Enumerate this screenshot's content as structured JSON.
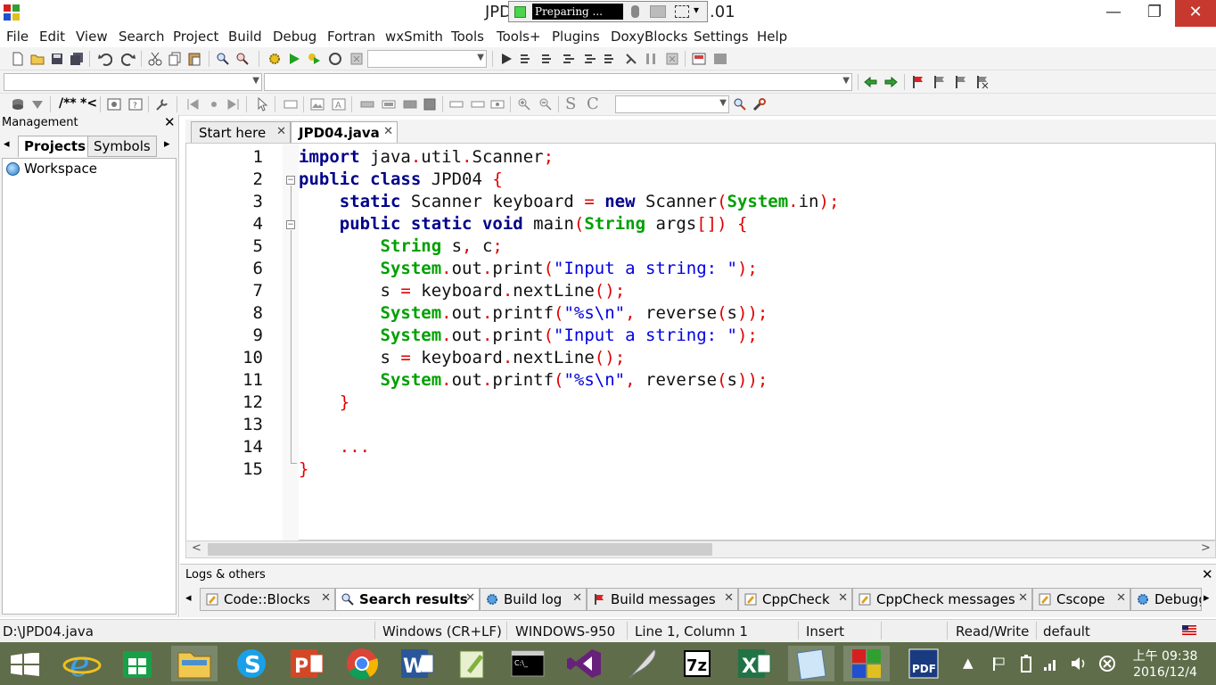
{
  "titlebar": {
    "title": "JPD",
    "title_suffix": ".01",
    "ime_status": "Preparing ...",
    "ime_arrow": "▾",
    "min": "—",
    "max": "❐",
    "close": "✕"
  },
  "menu": [
    "File",
    "Edit",
    "View",
    "Search",
    "Project",
    "Build",
    "Debug",
    "Fortran",
    "wxSmith",
    "Tools",
    "Tools+",
    "Plugins",
    "DoxyBlocks",
    "Settings",
    "Help"
  ],
  "toolbar3": {
    "doc_comment": "/**",
    "line_comment": "*<"
  },
  "management": {
    "title": "Management",
    "close": "✕",
    "tabs": [
      "Projects",
      "Symbols"
    ],
    "tab_left": "◂",
    "tab_right": "▸",
    "tree_root": "Workspace"
  },
  "editor": {
    "tabs": [
      {
        "label": "Start here",
        "active": false
      },
      {
        "label": "JPD04.java",
        "active": true
      }
    ],
    "tab_close": "✕",
    "lines": [
      "1",
      "2",
      "3",
      "4",
      "5",
      "6",
      "7",
      "8",
      "9",
      "10",
      "11",
      "12",
      "13",
      "14",
      "15"
    ],
    "fold_marker": "−",
    "code_tokens": {
      "import": "import",
      "import_path_1": " java",
      "import_path_2": "util",
      "import_path_3": "Scanner",
      "dot": ".",
      "semi": ";",
      "public": "public",
      "class": "class",
      "class_name": " JPD04 ",
      "lbrace": "{",
      "rbrace": "}",
      "static": "static",
      "scanner_type": " Scanner keyboard ",
      "eq": "=",
      "new": "new",
      "scanner_ctor": " Scanner",
      "lparen": "(",
      "rparen": ")",
      "system": "System",
      "in": "in",
      "void": "void",
      "main": " main",
      "string": "String",
      "args": " args",
      "brackets": "[]",
      "s_c": " s",
      "comma": ",",
      "c": " c",
      "out": "out",
      "print": "print",
      "printf": "printf",
      "prompt": "\"Input a string: \"",
      "fmt": "\"%s\\n\"",
      "reverse": " reverse",
      "s": "s",
      "s_assign": "s ",
      "keyboard": " keyboard",
      "nextline": "nextLine",
      "ellipsis": "..."
    },
    "hscroll_left": "<",
    "hscroll_right": ">"
  },
  "logs": {
    "title": "Logs & others",
    "close": "✕",
    "nav_left": "◂",
    "nav_right": "▸",
    "tabs": [
      {
        "label": "Code::Blocks",
        "icon": "note-icon"
      },
      {
        "label": "Search results",
        "icon": "search-icon",
        "active": true
      },
      {
        "label": "Build log",
        "icon": "gear-icon"
      },
      {
        "label": "Build messages",
        "icon": "flag-icon"
      },
      {
        "label": "CppCheck",
        "icon": "note-icon"
      },
      {
        "label": "CppCheck messages",
        "icon": "note-icon"
      },
      {
        "label": "Cscope",
        "icon": "note-icon"
      },
      {
        "label": "Debugger",
        "icon": "gear-icon"
      }
    ],
    "tab_close": "✕"
  },
  "status": {
    "file": "D:\\JPD04.java",
    "eol": "Windows (CR+LF)",
    "encoding": "WINDOWS-950",
    "position": "Line 1, Column 1",
    "mode": "Insert",
    "access": "Read/Write",
    "profile": "default"
  },
  "taskbar": {
    "apps": [
      "start",
      "ie",
      "store",
      "explorer",
      "skype",
      "powerpoint",
      "chrome",
      "word",
      "notepadpp",
      "cmd",
      "visualstudio",
      "quill",
      "7zip",
      "excel",
      "notepad",
      "codeblocks",
      "pdf"
    ],
    "seven_zip_label": "7z",
    "cmd_label": "C:\\_",
    "tray_arrow": "▲",
    "tray_close": "✕",
    "time": "上午 09:38",
    "date": "2016/12/4"
  },
  "colors": {
    "keyword": "#00008b",
    "type": "#00a000",
    "operator": "#e00000",
    "string": "#0000e0",
    "taskbar": "#5f6d4a"
  }
}
